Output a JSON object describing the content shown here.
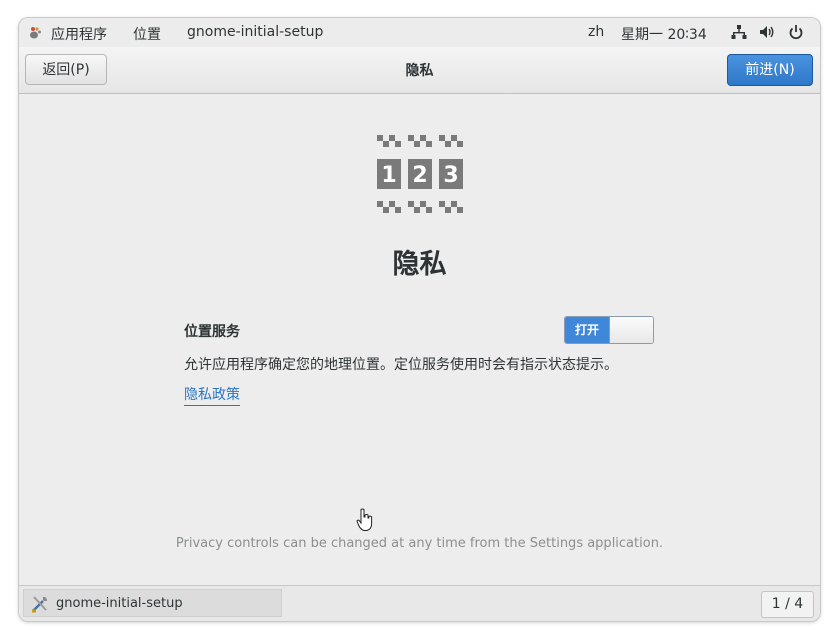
{
  "topbar": {
    "applications": "应用程序",
    "places": "位置",
    "app_name": "gnome-initial-setup",
    "input_method": "zh",
    "clock": "星期一 20∶34",
    "icons": [
      "network-icon",
      "volume-icon",
      "power-icon"
    ]
  },
  "header": {
    "back_label": "返回(P)",
    "title": "隐私",
    "next_label": "前进(N)"
  },
  "content": {
    "hero_icon": "privacy-icon",
    "page_title": "隐私",
    "location_label": "位置服务",
    "toggle_on_label": "打开",
    "toggle_state": "on",
    "description": "允许应用程序确定您的地理位置。定位服务使用时会有指示状态提示。",
    "policy_link": "隐私政策",
    "footer_note": "Privacy controls can be changed at any time from the Settings application."
  },
  "taskbar": {
    "task_label": "gnome-initial-setup",
    "workspace": "1 / 4"
  },
  "colors": {
    "accent": "#3f87d8",
    "link": "#2a76c6",
    "background": "#ededed"
  }
}
